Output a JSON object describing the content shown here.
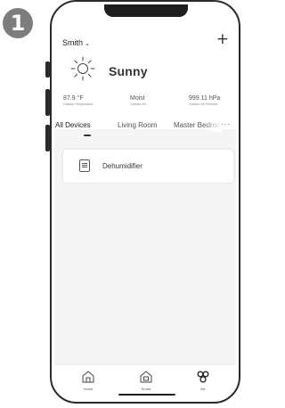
{
  "step_number": "1",
  "header": {
    "home_name": "Smith",
    "add_symbol": "+"
  },
  "weather": {
    "condition": "Sunny",
    "stats": [
      {
        "value": "87.9 °F",
        "label": "Outdoor Temperature"
      },
      {
        "value": "Moist",
        "label": "Outdoor Hu..."
      },
      {
        "value": "999.11 hPa",
        "label": "Outdoor Air Pressure"
      }
    ]
  },
  "tabs": [
    {
      "label": "All Devices",
      "active": true
    },
    {
      "label": "Living Room",
      "active": false
    },
    {
      "label": "Master Bedroo",
      "active": false
    }
  ],
  "more_symbol": "···",
  "devices": [
    {
      "name": "Dehumidifier",
      "icon": "dehumidifier-icon"
    }
  ],
  "tabbar": [
    {
      "label": "Home",
      "icon": "home-icon"
    },
    {
      "label": "Smart",
      "icon": "smart-icon"
    },
    {
      "label": "Me",
      "icon": "me-icon"
    }
  ]
}
